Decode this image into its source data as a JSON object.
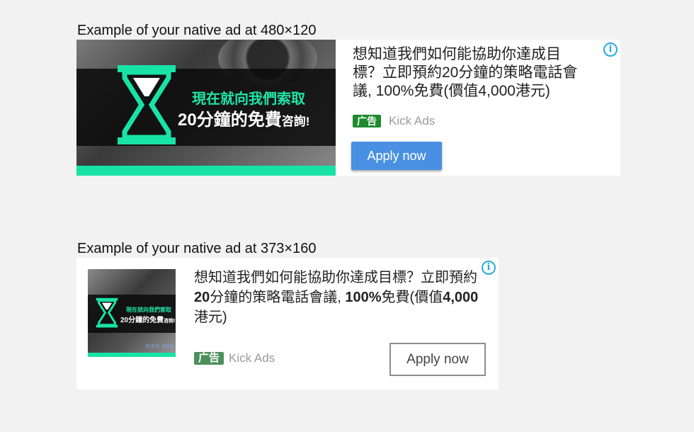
{
  "ad1": {
    "caption": "Example of your native ad at 480×120",
    "image_text_line1": "現在就向我們索取",
    "image_text_line2": "20分鐘的免費",
    "image_text_line2_small": "咨詢!",
    "headline": "想知道我們如何能協助你達成目標？立即預約20分鐘的策略電話會議, 100%免費(價值4,000港元)",
    "badge": "广告",
    "advertiser": "Kick Ads",
    "cta": "Apply now",
    "info_icon": "info-icon",
    "colors": {
      "cta_bg": "#4a90e2",
      "badge_bg": "#1d8a2c",
      "accent": "#18e3a6"
    }
  },
  "ad2": {
    "caption": "Example of your native ad at 373×160",
    "image_text_line1": "現在就向我們索取",
    "image_text_line2": "20分鐘的免費",
    "image_text_line2_small": "咨詢!",
    "image_brand": "KICK ADS",
    "headline_part1": "想知道我們如何能協助你達成目標？立即預約",
    "headline_bold1": "20",
    "headline_part2": "分鐘的策略電話會議, ",
    "headline_bold2": "100%",
    "headline_part3": "免費(價值",
    "headline_bold3": "4,000",
    "headline_part4": "港元)",
    "badge": "广告",
    "advertiser": "Kick Ads",
    "cta": "Apply now",
    "info_icon": "info-icon",
    "colors": {
      "badge_bg": "#4d8f5b",
      "cta_border": "#8d8d8d"
    }
  }
}
